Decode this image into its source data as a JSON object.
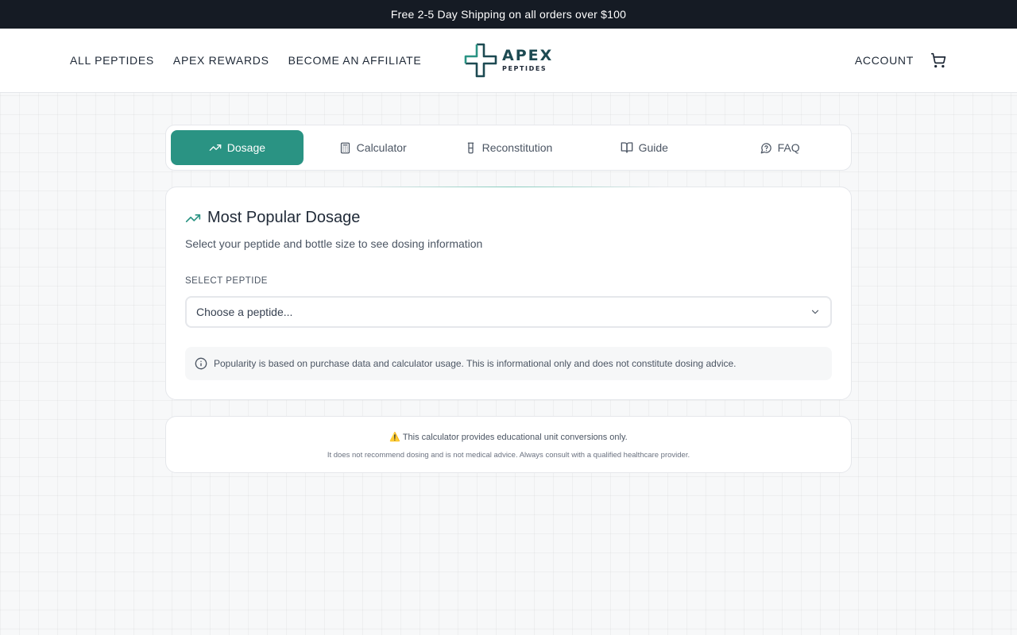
{
  "promo": {
    "text": "Free 2-5 Day Shipping on all orders over $100"
  },
  "nav": {
    "left": [
      "ALL PEPTIDES",
      "APEX REWARDS",
      "BECOME AN AFFILIATE"
    ],
    "account": "ACCOUNT",
    "cart_icon": "cart-icon"
  },
  "logo": {
    "name": "APEX",
    "sub": "PEPTIDES"
  },
  "tabs": [
    {
      "label": "Dosage",
      "icon": "trending-up-icon",
      "active": true
    },
    {
      "label": "Calculator",
      "icon": "calculator-icon",
      "active": false
    },
    {
      "label": "Reconstitution",
      "icon": "vial-icon",
      "active": false
    },
    {
      "label": "Guide",
      "icon": "book-open-icon",
      "active": false
    },
    {
      "label": "FAQ",
      "icon": "message-circle-icon",
      "active": false
    }
  ],
  "card": {
    "title": "Most Popular Dosage",
    "subtitle": "Select your peptide and bottle size to see dosing information",
    "field_label": "SELECT PEPTIDE",
    "select_placeholder": "Choose a peptide...",
    "info": "Popularity is based on purchase data and calculator usage. This is informational only and does not constitute dosing advice."
  },
  "disclaimer": {
    "icon": "⚠️",
    "line1": "This calculator provides educational unit conversions only.",
    "line2": "It does not recommend dosing and is not medical advice. Always consult with a qualified healthcare provider."
  },
  "colors": {
    "accent": "#2a9383",
    "promo_bg": "#151b24",
    "logo": "#1d4a52"
  }
}
